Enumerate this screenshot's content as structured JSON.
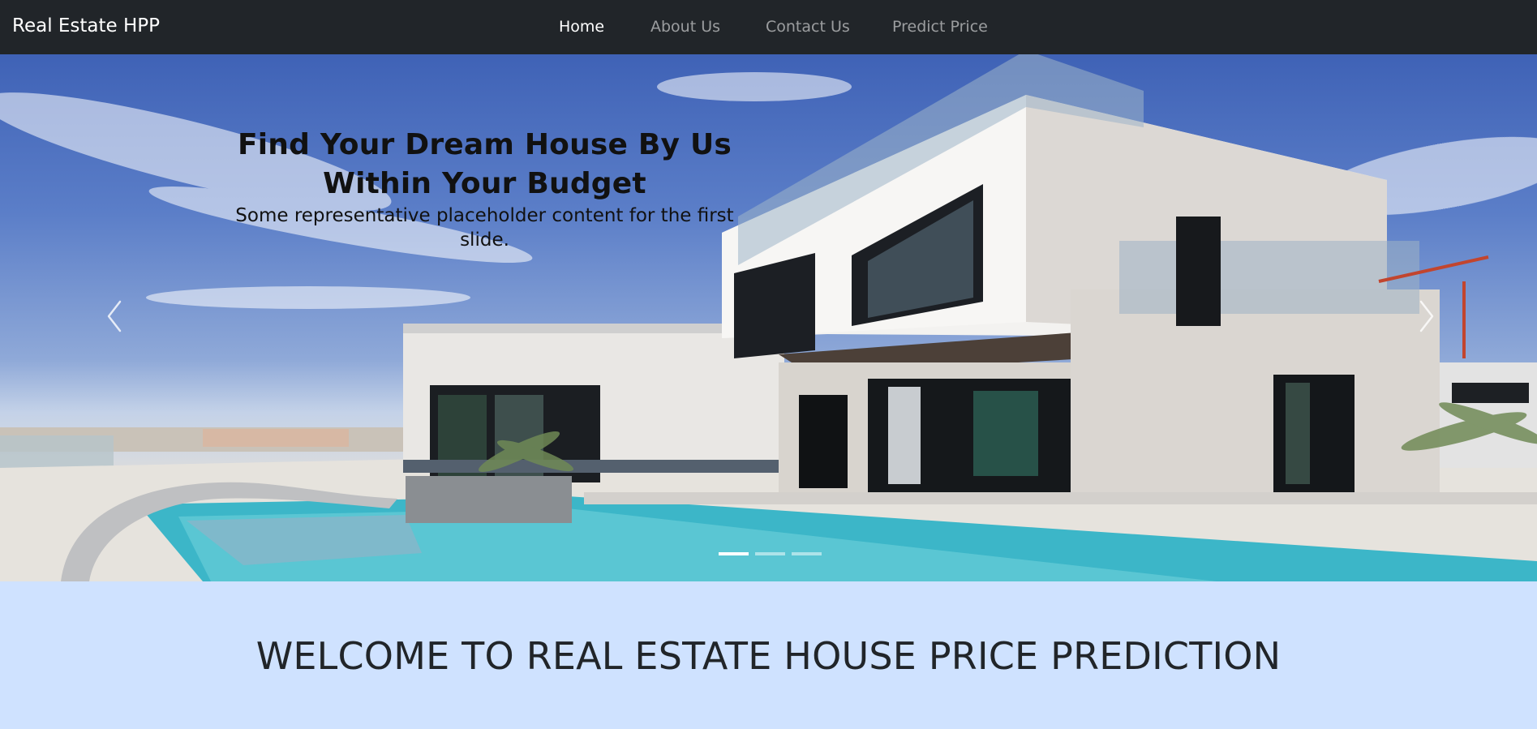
{
  "navbar": {
    "brand": "Real Estate HPP",
    "items": [
      {
        "label": "Home",
        "active": true
      },
      {
        "label": "About Us",
        "active": false
      },
      {
        "label": "Contact Us",
        "active": false
      },
      {
        "label": "Predict Price",
        "active": false
      }
    ]
  },
  "carousel": {
    "slide_title_line1": "Find Your Dream House By Us",
    "slide_title_line2": "Within Your Budget",
    "slide_text": "Some representative placeholder content for the first slide.",
    "prev_icon": "chevron-left-icon",
    "next_icon": "chevron-right-icon",
    "slide_count": 3,
    "active_slide": 1
  },
  "welcome": {
    "heading": "WELCOME TO REAL ESTATE HOUSE PRICE PREDICTION"
  },
  "colors": {
    "navbar_bg": "#212529",
    "nav_active": "#ffffff",
    "nav_inactive": "#8c8c8c",
    "welcome_bg": "#cfe2ff",
    "heading_text": "#212529"
  }
}
